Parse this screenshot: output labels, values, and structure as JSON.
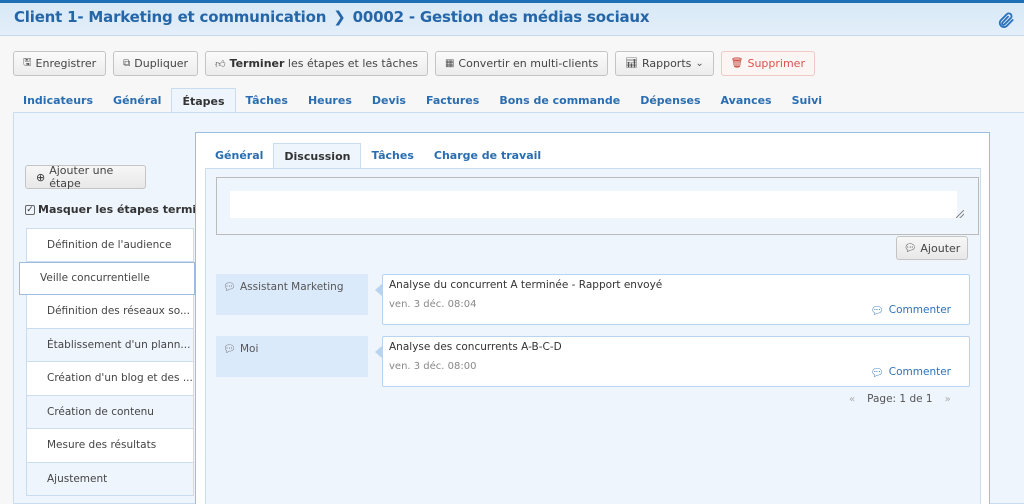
{
  "header": {
    "client": "Client 1- Marketing et communication",
    "separator": "❯",
    "project": "00002 - Gestion des médias sociaux",
    "attachment_icon": "paperclip-icon"
  },
  "toolbar": {
    "save": "Enregistrer",
    "duplicate": "Dupliquer",
    "finish_bold": "Terminer",
    "finish_rest": " les étapes et les tâches",
    "convert": "Convertir en multi-clients",
    "reports": "Rapports",
    "delete": "Supprimer"
  },
  "tabs": [
    "Indicateurs",
    "Général",
    "Étapes",
    "Tâches",
    "Heures",
    "Devis",
    "Factures",
    "Bons de commande",
    "Dépenses",
    "Avances",
    "Suivi"
  ],
  "active_tab": "Étapes",
  "sidebar": {
    "add_step": "Ajouter une étape",
    "hide_done": "Masquer les étapes terminées",
    "hide_done_checked": true,
    "steps": [
      "Définition de l'audience",
      "Veille concurrentielle",
      "Définition des réseaux so...",
      "Établissement d'un plann...",
      "Création d'un blog et des ...",
      "Création de contenu",
      "Mesure des résultats",
      "Ajustement"
    ],
    "active_step": "Veille concurrentielle"
  },
  "subtabs": [
    "Général",
    "Discussion",
    "Tâches",
    "Charge de travail"
  ],
  "active_subtab": "Discussion",
  "discussion": {
    "input_value": "",
    "add_button": "Ajouter",
    "messages": [
      {
        "author": "Assistant Marketing",
        "text": "Analyse du concurrent A terminée - Rapport envoyé",
        "date": "ven. 3 déc. 08:04",
        "comment": "Commenter"
      },
      {
        "author": "Moi",
        "text": "Analyse des concurrents A-B-C-D",
        "date": "ven. 3 déc. 08:00",
        "comment": "Commenter"
      }
    ],
    "pager": {
      "prev": "«",
      "label": "Page: 1 de 1",
      "next": "»"
    }
  }
}
